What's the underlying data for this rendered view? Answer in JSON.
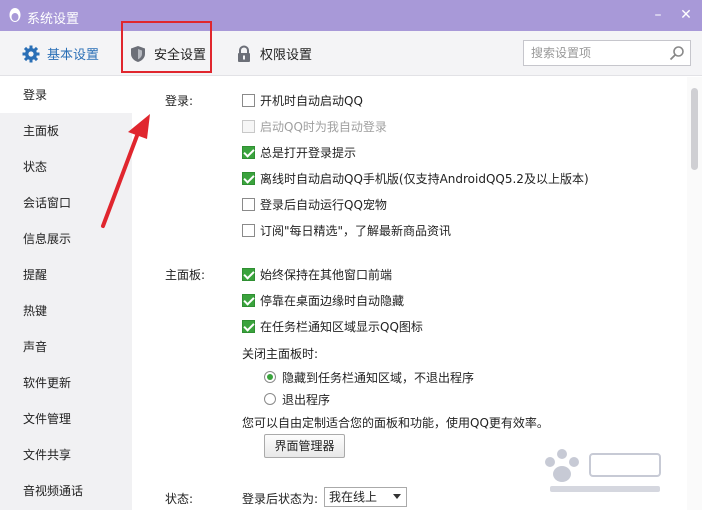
{
  "window": {
    "title": "系统设置",
    "minimize_glyph": "–",
    "close_glyph": "✕"
  },
  "tabs": [
    {
      "label": "基本设置",
      "icon": "gear-icon",
      "active": true
    },
    {
      "label": "安全设置",
      "icon": "shield-icon",
      "active": false
    },
    {
      "label": "权限设置",
      "icon": "lock-icon",
      "active": false
    }
  ],
  "search": {
    "placeholder": "搜索设置项",
    "value": ""
  },
  "sidebar": {
    "items": [
      {
        "label": "登录",
        "active": true
      },
      {
        "label": "主面板"
      },
      {
        "label": "状态"
      },
      {
        "label": "会话窗口"
      },
      {
        "label": "信息展示"
      },
      {
        "label": "提醒"
      },
      {
        "label": "热键"
      },
      {
        "label": "声音"
      },
      {
        "label": "软件更新"
      },
      {
        "label": "文件管理"
      },
      {
        "label": "文件共享"
      },
      {
        "label": "音视频通话"
      }
    ]
  },
  "login_section": {
    "label": "登录:",
    "options": [
      {
        "label": "开机时自动启动QQ",
        "checked": false,
        "disabled": false
      },
      {
        "label": "启动QQ时为我自动登录",
        "checked": false,
        "disabled": true
      },
      {
        "label": "总是打开登录提示",
        "checked": true,
        "disabled": false
      },
      {
        "label": "离线时自动启动QQ手机版(仅支持AndroidQQ5.2及以上版本)",
        "checked": true,
        "disabled": false
      },
      {
        "label": "登录后自动运行QQ宠物",
        "checked": false,
        "disabled": false
      },
      {
        "label": "订阅\"每日精选\"，了解最新商品资讯",
        "checked": false,
        "disabled": false
      }
    ]
  },
  "panel_section": {
    "label": "主面板:",
    "options": [
      {
        "label": "始终保持在其他窗口前端",
        "checked": true
      },
      {
        "label": "停靠在桌面边缘时自动隐藏",
        "checked": true
      },
      {
        "label": "在任务栏通知区域显示QQ图标",
        "checked": true
      }
    ],
    "close_label": "关闭主面板时:",
    "close_options": [
      {
        "label": "隐藏到任务栏通知区域，不退出程序",
        "selected": true
      },
      {
        "label": "退出程序",
        "selected": false
      }
    ],
    "custom_text": "您可以自由定制适合您的面板和功能，使用QQ更有效率。",
    "manager_button": "界面管理器"
  },
  "status_section": {
    "label": "状态:",
    "after_login_label": "登录后状态为:",
    "status_value": "我在线上"
  },
  "colors": {
    "titlebar": "#a899d8",
    "accent": "#2a6fb6",
    "check": "#3aa33d",
    "highlight": "#e0262e"
  }
}
